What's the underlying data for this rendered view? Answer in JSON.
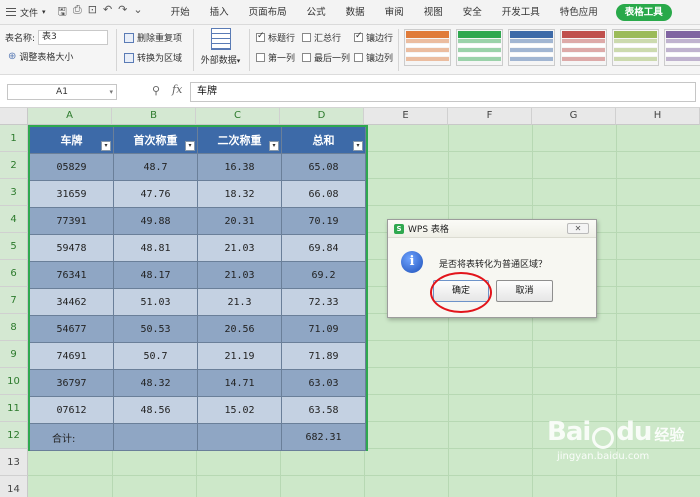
{
  "menubar": {
    "file_label": "文件",
    "tabs": [
      "开始",
      "插入",
      "页面布局",
      "公式",
      "数据",
      "审阅",
      "视图",
      "安全",
      "开发工具",
      "特色应用"
    ],
    "active_tab": "表格工具"
  },
  "ribbon": {
    "table_name_label": "表名称:",
    "table_name_value": "表3",
    "resize_label": "调整表格大小",
    "remove_dup_label": "删除重复项",
    "convert_range_label": "转换为区域",
    "external_data_label": "外部数据",
    "options": [
      {
        "label": "标题行",
        "checked": true
      },
      {
        "label": "汇总行",
        "checked": false
      },
      {
        "label": "镶边行",
        "checked": true
      },
      {
        "label": "第一列",
        "checked": false
      },
      {
        "label": "最后一列",
        "checked": false
      },
      {
        "label": "镶边列",
        "checked": false
      }
    ],
    "style_colors": [
      "#e07b39",
      "#2fa84f",
      "#3d6aa8",
      "#c0504d",
      "#9bbb59",
      "#8064a2"
    ]
  },
  "formula_bar": {
    "cell_ref": "A1",
    "fx_label": "fx",
    "content": "车牌"
  },
  "sheet": {
    "columns": [
      "A",
      "B",
      "C",
      "D",
      "E",
      "F",
      "G",
      "H"
    ],
    "rows": [
      "1",
      "2",
      "3",
      "4",
      "5",
      "6",
      "7",
      "8",
      "9",
      "10",
      "11",
      "12",
      "13",
      "14"
    ],
    "table_headers": [
      "车牌",
      "首次称重",
      "二次称重",
      "总和"
    ],
    "table_rows": [
      [
        "05829",
        "48.7",
        "16.38",
        "65.08"
      ],
      [
        "31659",
        "47.76",
        "18.32",
        "66.08"
      ],
      [
        "77391",
        "49.88",
        "20.31",
        "70.19"
      ],
      [
        "59478",
        "48.81",
        "21.03",
        "69.84"
      ],
      [
        "76341",
        "48.17",
        "21.03",
        "69.2"
      ],
      [
        "34462",
        "51.03",
        "21.3",
        "72.33"
      ],
      [
        "54677",
        "50.53",
        "20.56",
        "71.09"
      ],
      [
        "74691",
        "50.7",
        "21.19",
        "71.89"
      ],
      [
        "36797",
        "48.32",
        "14.71",
        "63.03"
      ],
      [
        "07612",
        "48.56",
        "15.02",
        "63.58"
      ]
    ],
    "total_label": "合计:",
    "total_value": "682.31"
  },
  "dialog": {
    "title": "WPS 表格",
    "message": "是否将表转化为普通区域？",
    "ok_label": "确定",
    "cancel_label": "取消"
  },
  "watermark": {
    "brand": "Bai du 经验",
    "brand_left": "Bai",
    "brand_right": "du",
    "brand_cn": "经验",
    "url": "jingyan.baidu.com"
  }
}
